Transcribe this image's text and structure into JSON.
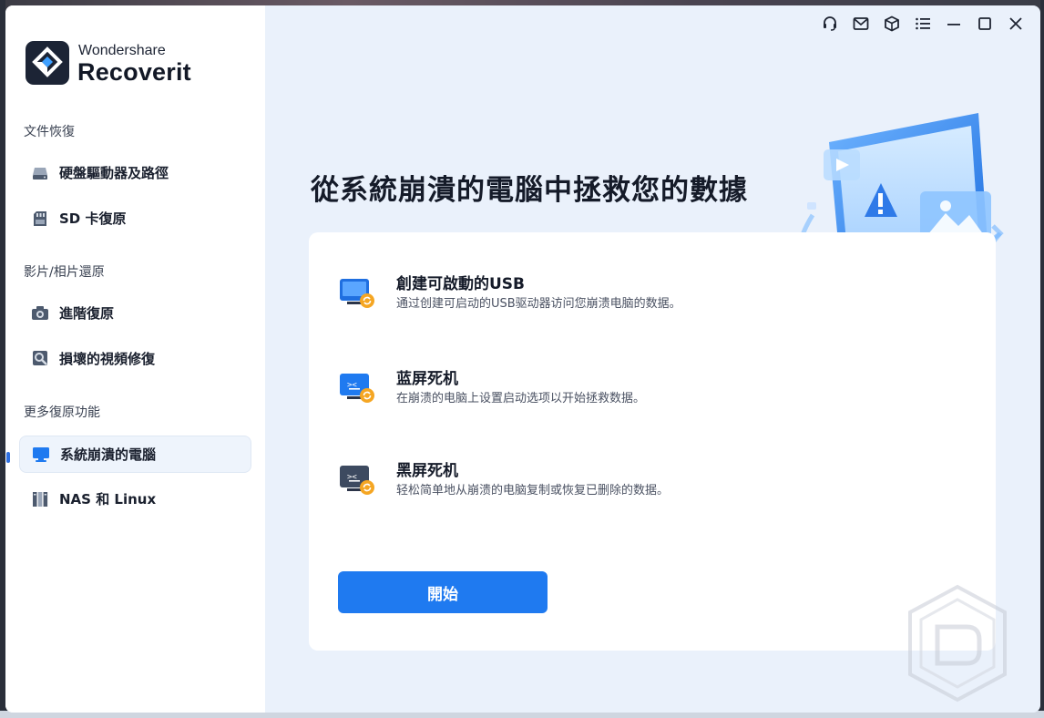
{
  "brand": {
    "company": "Wondershare",
    "product": "Recoverit"
  },
  "sidebar": {
    "sections": [
      {
        "label": "文件恢復",
        "items": [
          {
            "label": "硬盤驅動器及路徑",
            "icon": "hard-drive-icon"
          },
          {
            "label": "SD 卡復原",
            "icon": "sd-card-icon"
          }
        ]
      },
      {
        "label": "影片/相片還原",
        "items": [
          {
            "label": "進階復原",
            "icon": "camera-icon"
          },
          {
            "label": "損壞的視頻修復",
            "icon": "video-repair-icon"
          }
        ]
      },
      {
        "label": "更多復原功能",
        "items": [
          {
            "label": "系統崩潰的電腦",
            "icon": "monitor-icon",
            "active": true
          },
          {
            "label": "NAS 和 Linux",
            "icon": "nas-icon"
          }
        ]
      }
    ]
  },
  "titlebar": {
    "icons": [
      "headset-icon",
      "mail-icon",
      "cube-icon",
      "menu-icon",
      "minimize-icon",
      "maximize-icon",
      "close-icon"
    ]
  },
  "main": {
    "headline": "從系統崩潰的電腦中拯救您的數據",
    "options": [
      {
        "title": "創建可啟動的USB",
        "desc": "通过创建可启动的USB驱动器访问您崩溃电脑的数据。",
        "icon": "usb-boot-icon"
      },
      {
        "title": "蓝屏死机",
        "desc": "在崩溃的电脑上设置启动选项以开始拯救数据。",
        "icon": "blue-screen-icon"
      },
      {
        "title": "黑屏死机",
        "desc": "轻松简单地从崩溃的电脑复制或恢复已删除的数据。",
        "icon": "black-screen-icon"
      }
    ],
    "start_label": "開始"
  },
  "colors": {
    "accent": "#1f7af0",
    "sidebar_bg": "#ffffff",
    "main_bg": "#eaf1fb"
  }
}
